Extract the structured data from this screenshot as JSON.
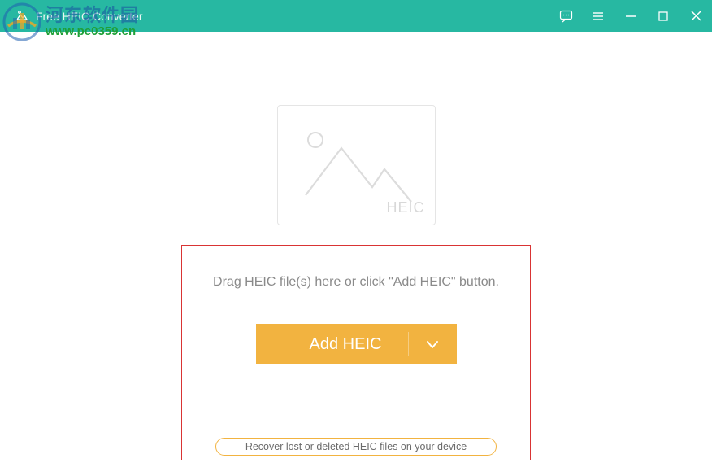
{
  "titlebar": {
    "app_title": "Free HEIC Converter"
  },
  "placeholder": {
    "format_label": "HEIC"
  },
  "drop": {
    "instruction": "Drag HEIC file(s) here or click \"Add HEIC\" button.",
    "add_button_label": "Add HEIC",
    "recover_button_label": "Recover lost or deleted HEIC files on your device"
  },
  "watermark": {
    "cn_text": "河东软件园",
    "url": "www.pc0359.cn"
  },
  "colors": {
    "titlebar_bg": "#27b8a2",
    "accent_orange": "#f2b340",
    "highlight_border": "#d93434"
  }
}
